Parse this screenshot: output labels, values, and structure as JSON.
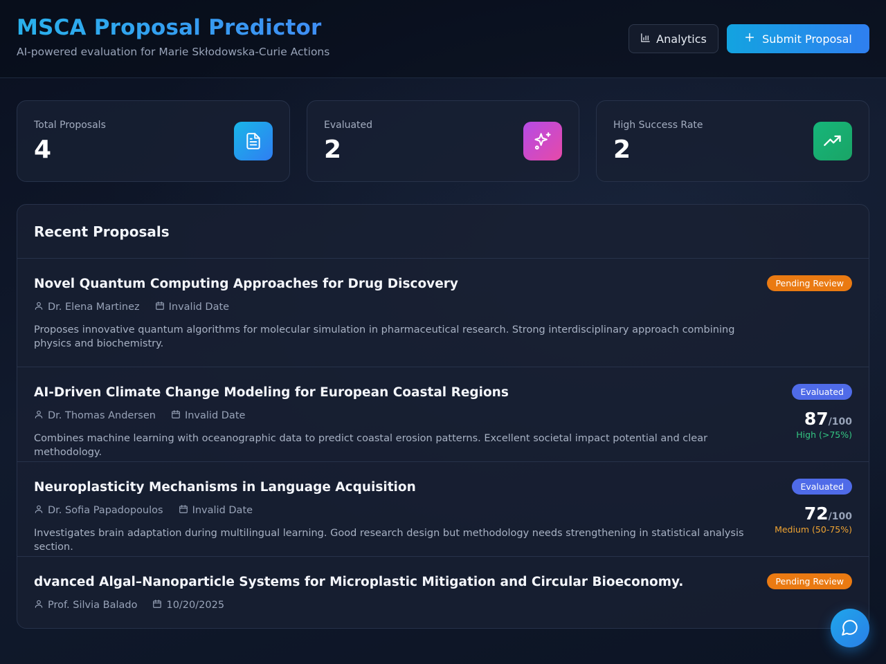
{
  "header": {
    "title": "MSCA Proposal Predictor",
    "subtitle": "AI-powered evaluation for Marie Skłodowska-Curie Actions",
    "analytics_label": "Analytics",
    "submit_label": "Submit Proposal"
  },
  "stats": [
    {
      "label": "Total Proposals",
      "value": "4",
      "icon": "document-icon"
    },
    {
      "label": "Evaluated",
      "value": "2",
      "icon": "sparkles-icon"
    },
    {
      "label": "High Success Rate",
      "value": "2",
      "icon": "trending-up-icon"
    }
  ],
  "recent": {
    "title": "Recent Proposals",
    "proposals": [
      {
        "title": "Novel Quantum Computing Approaches for Drug Discovery",
        "author": "Dr. Elena Martinez",
        "date": "Invalid Date",
        "description": "Proposes innovative quantum algorithms for molecular simulation in pharmaceutical research. Strong interdisciplinary approach combining physics and biochemistry.",
        "status": "Pending Review"
      },
      {
        "title": "AI-Driven Climate Change Modeling for European Coastal Regions",
        "author": "Dr. Thomas Andersen",
        "date": "Invalid Date",
        "description": "Combines machine learning with oceanographic data to predict coastal erosion patterns. Excellent societal impact potential and clear methodology.",
        "status": "Evaluated",
        "score": "87",
        "score_max": "/100",
        "level": "High (>75%)"
      },
      {
        "title": "Neuroplasticity Mechanisms in Language Acquisition",
        "author": "Dr. Sofia Papadopoulos",
        "date": "Invalid Date",
        "description": "Investigates brain adaptation during multilingual learning. Good research design but methodology needs strengthening in statistical analysis section.",
        "status": "Evaluated",
        "score": "72",
        "score_max": "/100",
        "level": "Medium (50-75%)"
      },
      {
        "title": "dvanced Algal–Nanoparticle Systems for Microplastic Mitigation and Circular Bioeconomy.",
        "author": "Prof. Silvia Balado",
        "date": "10/20/2025",
        "status": "Pending Review"
      }
    ]
  },
  "colors": {
    "accent": "#2f7ff0",
    "pending": "#ea7a12",
    "evaluated": "#4f6be8",
    "high": "#34c783",
    "medium": "#f0a432"
  }
}
